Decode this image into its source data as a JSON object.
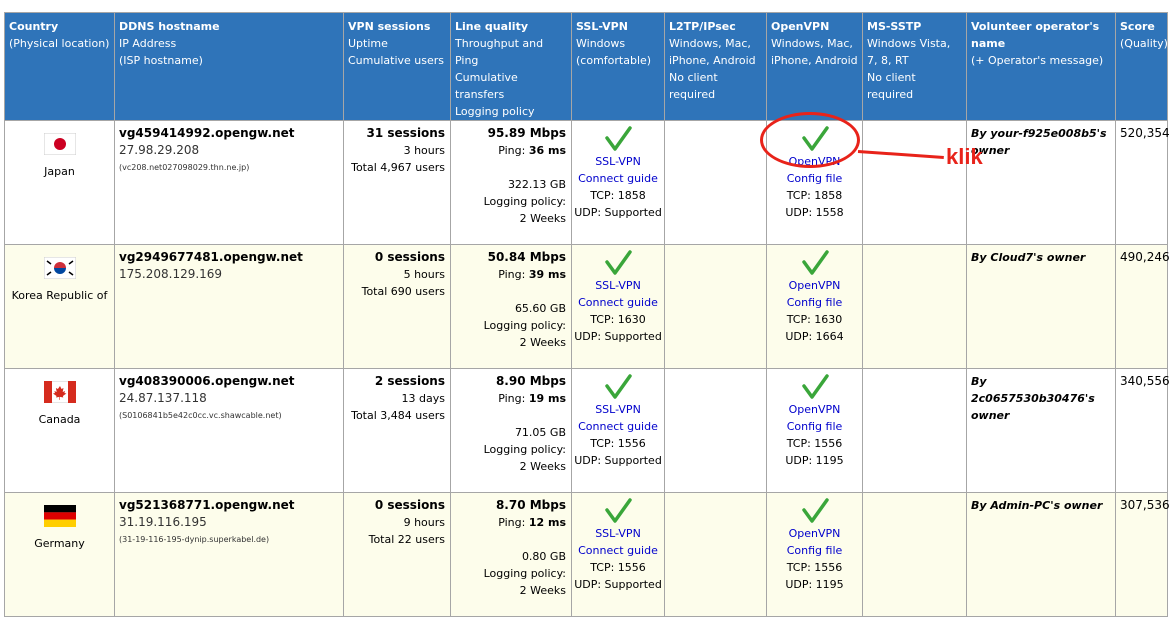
{
  "headers": [
    {
      "title": "Country",
      "lines": [
        "(Physical location)"
      ]
    },
    {
      "title": "DDNS hostname",
      "lines": [
        "IP Address",
        "(ISP hostname)"
      ]
    },
    {
      "title": "VPN sessions",
      "lines": [
        "Uptime",
        "Cumulative users"
      ]
    },
    {
      "title": "Line quality",
      "lines": [
        "Throughput and Ping",
        "Cumulative transfers",
        "Logging policy"
      ]
    },
    {
      "title": "SSL-VPN",
      "lines": [
        "Windows",
        "(comfortable)"
      ]
    },
    {
      "title": "L2TP/IPsec",
      "lines": [
        "Windows, Mac,",
        "iPhone, Android",
        "No client required"
      ]
    },
    {
      "title": "OpenVPN",
      "lines": [
        "Windows, Mac,",
        "iPhone, Android"
      ]
    },
    {
      "title": "MS-SSTP",
      "lines": [
        "Windows Vista,",
        "7, 8, RT",
        "No client required"
      ]
    },
    {
      "title": "Volunteer operator's name",
      "lines": [
        "(+ Operator's message)"
      ]
    },
    {
      "title": "Score",
      "lines": [
        "(Quality)"
      ]
    }
  ],
  "servers": [
    {
      "country": "Japan",
      "flag": "japan-flag-icon",
      "hostname": "vg459414992.opengw.net",
      "ip": "27.98.29.208",
      "isp": "(vc208.net027098029.thn.ne.jp)",
      "sessions": "31 sessions",
      "uptime": "3 hours",
      "cumulative": "Total 4,967 users",
      "speed": "95.89 Mbps",
      "ping_label": "Ping:",
      "ping": "36 ms",
      "transfer": "322.13 GB",
      "logging_label": "Logging policy:",
      "logging": "2 Weeks",
      "ssl_link1": "SSL-VPN",
      "ssl_link2": "Connect guide",
      "ssl_tcp": "TCP: 1858",
      "ssl_udp": "UDP: Supported",
      "ovpn_link1": "OpenVPN",
      "ovpn_link2": "Config file",
      "ovpn_tcp": "TCP: 1858",
      "ovpn_udp": "UDP: 1558",
      "operator": "By your-f925e008b5's owner",
      "score": "520,354"
    },
    {
      "country": "Korea Republic of",
      "flag": "korea-flag-icon",
      "hostname": "vg2949677481.opengw.net",
      "ip": "175.208.129.169",
      "isp": "",
      "sessions": "0 sessions",
      "uptime": "5 hours",
      "cumulative": "Total 690 users",
      "speed": "50.84 Mbps",
      "ping_label": "Ping:",
      "ping": "39 ms",
      "transfer": "65.60 GB",
      "logging_label": "Logging policy:",
      "logging": "2 Weeks",
      "ssl_link1": "SSL-VPN",
      "ssl_link2": "Connect guide",
      "ssl_tcp": "TCP: 1630",
      "ssl_udp": "UDP: Supported",
      "ovpn_link1": "OpenVPN",
      "ovpn_link2": "Config file",
      "ovpn_tcp": "TCP: 1630",
      "ovpn_udp": "UDP: 1664",
      "operator": "By Cloud7's owner",
      "score": "490,246"
    },
    {
      "country": "Canada",
      "flag": "canada-flag-icon",
      "hostname": "vg408390006.opengw.net",
      "ip": "24.87.137.118",
      "isp": "(S0106841b5e42c0cc.vc.shawcable.net)",
      "sessions": "2 sessions",
      "uptime": "13 days",
      "cumulative": "Total 3,484 users",
      "speed": "8.90 Mbps",
      "ping_label": "Ping:",
      "ping": "19 ms",
      "transfer": "71.05 GB",
      "logging_label": "Logging policy:",
      "logging": "2 Weeks",
      "ssl_link1": "SSL-VPN",
      "ssl_link2": "Connect guide",
      "ssl_tcp": "TCP: 1556",
      "ssl_udp": "UDP: Supported",
      "ovpn_link1": "OpenVPN",
      "ovpn_link2": "Config file",
      "ovpn_tcp": "TCP: 1556",
      "ovpn_udp": "UDP: 1195",
      "operator": "By 2c0657530b30476's owner",
      "score": "340,556"
    },
    {
      "country": "Germany",
      "flag": "germany-flag-icon",
      "hostname": "vg521368771.opengw.net",
      "ip": "31.19.116.195",
      "isp": "(31-19-116-195-dynip.superkabel.de)",
      "sessions": "0 sessions",
      "uptime": "9 hours",
      "cumulative": "Total 22 users",
      "speed": "8.70 Mbps",
      "ping_label": "Ping:",
      "ping": "12 ms",
      "transfer": "0.80 GB",
      "logging_label": "Logging policy:",
      "logging": "2 Weeks",
      "ssl_link1": "SSL-VPN",
      "ssl_link2": "Connect guide",
      "ssl_tcp": "TCP: 1556",
      "ssl_udp": "UDP: Supported",
      "ovpn_link1": "OpenVPN",
      "ovpn_link2": "Config file",
      "ovpn_tcp": "TCP: 1556",
      "ovpn_udp": "UDP: 1195",
      "operator": "By Admin-PC's owner",
      "score": "307,536"
    }
  ],
  "annotation": {
    "label": "klik",
    "color": "#e8231a"
  },
  "colors": {
    "header_bg": "#2f74b9",
    "row_alt_bg": "#fdfdeb",
    "link": "#0000cc",
    "check": "#3aa63a"
  }
}
